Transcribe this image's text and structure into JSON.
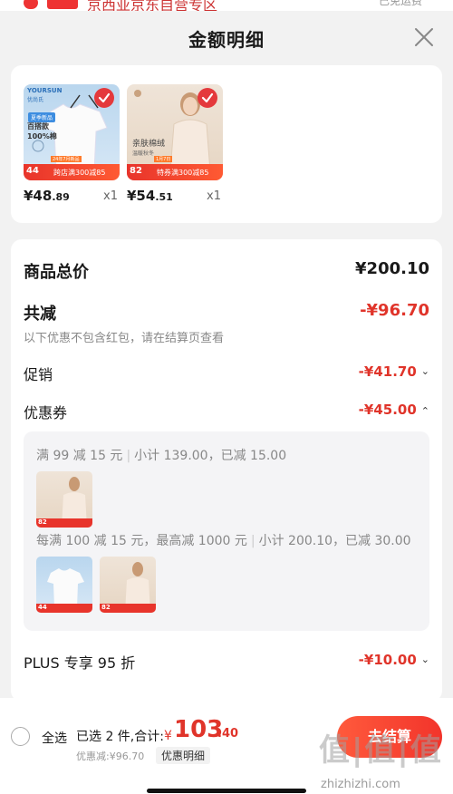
{
  "top_strip": {
    "badge": "京东",
    "text": "京西亚京东自营专区",
    "right": "已免运费"
  },
  "header": {
    "title": "金额明细"
  },
  "products": [
    {
      "brand": "YOURSUN",
      "brand_sub": "优尚氏",
      "tag": "夏季新品",
      "line1": "百搭款",
      "line2": "100%棉",
      "badge_num": "44",
      "badge_top": "24年7月新品",
      "badge_promo": "跨店满300减85",
      "price_int": "¥48",
      "price_dec": ".89",
      "qty": "x1"
    },
    {
      "name1": "亲肤棉绒",
      "name2": "温暖秋冬",
      "badge_num": "82",
      "badge_top": "1月7日",
      "badge_promo": "特券满300减85",
      "price_int": "¥54",
      "price_dec": ".51",
      "qty": "x1"
    }
  ],
  "summary": {
    "goods_total_label": "商品总价",
    "goods_total": "¥200.10",
    "total_reduce_label": "共减",
    "total_reduce": "-¥96.70",
    "note": "以下优惠不包含红包，请在结算页查看",
    "promo_label": "促销",
    "promo_value": "-¥41.70",
    "coupon_label": "优惠券",
    "coupon_value": "-¥45.00",
    "plus_label": "PLUS 专享 95 折",
    "plus_value": "-¥10.00"
  },
  "coupon_details": [
    {
      "rule": "满 99 减 15 元",
      "detail": "小计 139.00，已减 15.00"
    },
    {
      "rule": "每满 100 减 15 元，最高减 1000 元",
      "detail": "小计 200.10，已减 30.00"
    }
  ],
  "thumb_badges": [
    "82",
    "44",
    "82"
  ],
  "footer": {
    "select_all": "全选",
    "selected": "已选 2 件,合计:",
    "yen": "¥",
    "total_int": "103",
    "total_dec": ".40",
    "discount": "优惠减:¥96.70",
    "detail_link": "优惠明细",
    "checkout": "去结算"
  },
  "watermark": {
    "main": "值|值|值",
    "url": "zhizhizhi.com"
  },
  "colors": {
    "accent": "#e0342a",
    "checkout_gradient_start": "#ff5a3c",
    "checkout_gradient_end": "#f2342b"
  }
}
